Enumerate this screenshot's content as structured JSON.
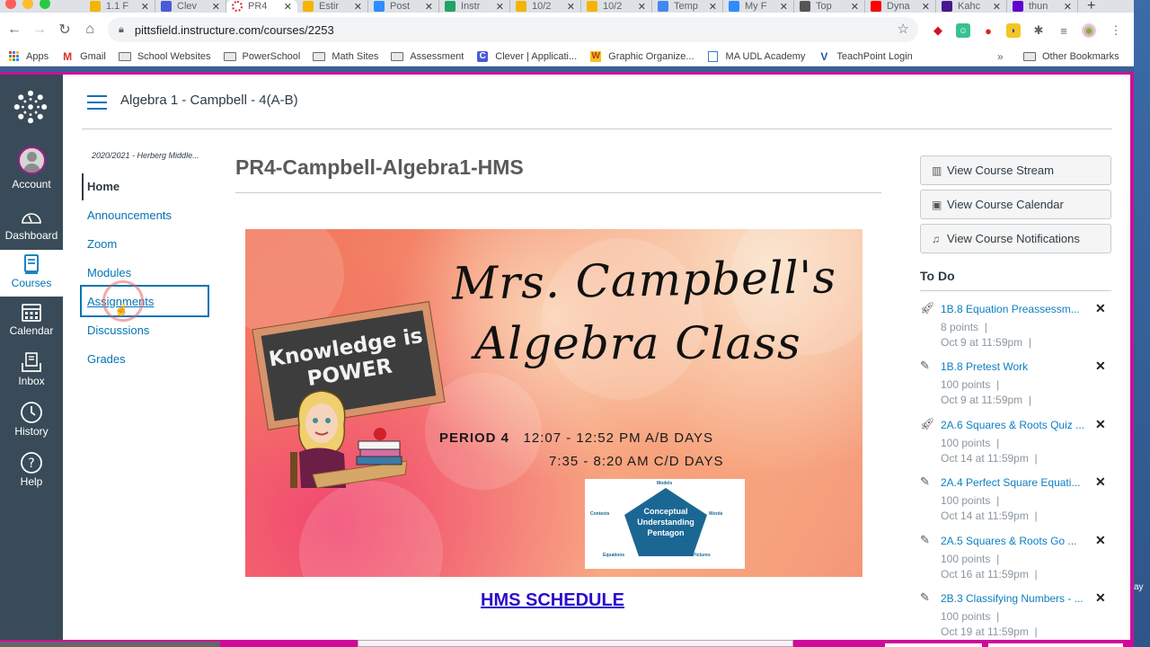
{
  "browser": {
    "tabs": [
      {
        "label": "1.1 F",
        "favicon": "doc-icon",
        "color": "#f4b400",
        "active": false
      },
      {
        "label": "Clev",
        "favicon": "clever-icon",
        "color": "#4a5ad8",
        "active": false
      },
      {
        "label": "PR4",
        "favicon": "canvas-icon",
        "color": "#d42b2b",
        "active": true
      },
      {
        "label": "Estir",
        "favicon": "doc-icon",
        "color": "#f4b400",
        "active": false
      },
      {
        "label": "Post",
        "favicon": "zoom-icon",
        "color": "#2d8cff",
        "active": false
      },
      {
        "label": "Instr",
        "favicon": "drive-icon",
        "color": "#1fa463",
        "active": false
      },
      {
        "label": "10/2",
        "favicon": "doc-icon",
        "color": "#f4b400",
        "active": false
      },
      {
        "label": "10/2",
        "favicon": "doc-icon",
        "color": "#f4b400",
        "active": false
      },
      {
        "label": "Temp",
        "favicon": "gdocs-icon",
        "color": "#4285f4",
        "active": false
      },
      {
        "label": "My F",
        "favicon": "zoom-icon",
        "color": "#2d8cff",
        "active": false
      },
      {
        "label": "Top",
        "favicon": "generic-icon",
        "color": "#555555",
        "active": false
      },
      {
        "label": "Dyna",
        "favicon": "youtube-icon",
        "color": "#ff0000",
        "active": false
      },
      {
        "label": "Kahc",
        "favicon": "kahoot-icon",
        "color": "#46178f",
        "active": false
      },
      {
        "label": "thun",
        "favicon": "yahoo-icon",
        "color": "#6001d2",
        "active": false
      }
    ],
    "new_tab": "+",
    "url": "pittsfield.instructure.com/courses/2253",
    "bookmarks": [
      {
        "label": "Apps",
        "icon": "apps-grid-icon"
      },
      {
        "label": "Gmail",
        "icon": "gmail-icon"
      },
      {
        "label": "School Websites",
        "icon": "folder-icon"
      },
      {
        "label": "PowerSchool",
        "icon": "folder-icon"
      },
      {
        "label": "Math Sites",
        "icon": "folder-icon"
      },
      {
        "label": "Assessment",
        "icon": "folder-icon"
      },
      {
        "label": "Clever | Applicati...",
        "icon": "clever-icon"
      },
      {
        "label": "Graphic Organize...",
        "icon": "w-icon"
      },
      {
        "label": "MA UDL Academy",
        "icon": "page-icon"
      },
      {
        "label": "TeachPoint Login",
        "icon": "v-icon"
      }
    ],
    "overflow": "»",
    "other_bookmarks": "Other Bookmarks"
  },
  "global_nav": {
    "items": [
      {
        "label": "Account",
        "icon": "avatar-icon"
      },
      {
        "label": "Dashboard",
        "icon": "dashboard-icon"
      },
      {
        "label": "Courses",
        "icon": "courses-icon",
        "active": true
      },
      {
        "label": "Calendar",
        "icon": "calendar-icon"
      },
      {
        "label": "Inbox",
        "icon": "inbox-icon"
      },
      {
        "label": "History",
        "icon": "history-icon"
      },
      {
        "label": "Help",
        "icon": "help-icon"
      }
    ]
  },
  "header": {
    "breadcrumb": "Algebra 1 - Campbell - 4(A-B)"
  },
  "course_nav": {
    "term": "2020/2021 - Herberg Middle...",
    "items": [
      {
        "label": "Home",
        "active": true
      },
      {
        "label": "Announcements"
      },
      {
        "label": "Zoom"
      },
      {
        "label": "Modules"
      },
      {
        "label": "Assignments",
        "focused": true
      },
      {
        "label": "Discussions"
      },
      {
        "label": "Grades"
      }
    ]
  },
  "main": {
    "title": "PR4-Campbell-Algebra1-HMS",
    "banner": {
      "script_line1": "Mrs. Campbell's",
      "script_line2": "Algebra Class",
      "chalk_line1": "Knowledge is",
      "chalk_line2": "POWER",
      "period_label": "PERIOD 4",
      "times_line1": "12:07 - 12:52 PM A/B DAYS",
      "times_line2": "7:35 - 8:20 AM C/D DAYS",
      "pentagon": {
        "center": [
          "Conceptual",
          "Understanding",
          "Pentagon"
        ],
        "top": "Models",
        "left": "Contexts",
        "right": "Words",
        "bottom_left": "Equations",
        "bottom_right": "Pictures"
      }
    },
    "schedule_link": "HMS SCHEDULE"
  },
  "sidebar": {
    "buttons": [
      {
        "label": "View Course Stream",
        "icon": "stream-icon"
      },
      {
        "label": "View Course Calendar",
        "icon": "calendar-icon"
      },
      {
        "label": "View Course Notifications",
        "icon": "bell-icon"
      }
    ],
    "todo_heading": "To Do",
    "todos": [
      {
        "title": "1B.8 Equation Preassessm...",
        "points": "8 points",
        "due": "Oct 9 at 11:59pm",
        "icon": "quiz-rocket-icon"
      },
      {
        "title": "1B.8 Pretest Work",
        "points": "100 points",
        "due": "Oct 9 at 11:59pm",
        "icon": "assignment-icon"
      },
      {
        "title": "2A.6 Squares & Roots Quiz ...",
        "points": "100 points",
        "due": "Oct 14 at 11:59pm",
        "icon": "quiz-rocket-icon"
      },
      {
        "title": "2A.4 Perfect Square Equati...",
        "points": "100 points",
        "due": "Oct 14 at 11:59pm",
        "icon": "assignment-icon"
      },
      {
        "title": "2A.5 Squares & Roots Go ...",
        "points": "100 points",
        "due": "Oct 16 at 11:59pm",
        "icon": "assignment-icon"
      },
      {
        "title": "2B.3 Classifying Numbers - ...",
        "points": "100 points",
        "due": "Oct 19 at 11:59pm",
        "icon": "assignment-icon"
      }
    ],
    "separator": "|",
    "dismiss": "✕"
  },
  "desktop_edge_text": "ay"
}
